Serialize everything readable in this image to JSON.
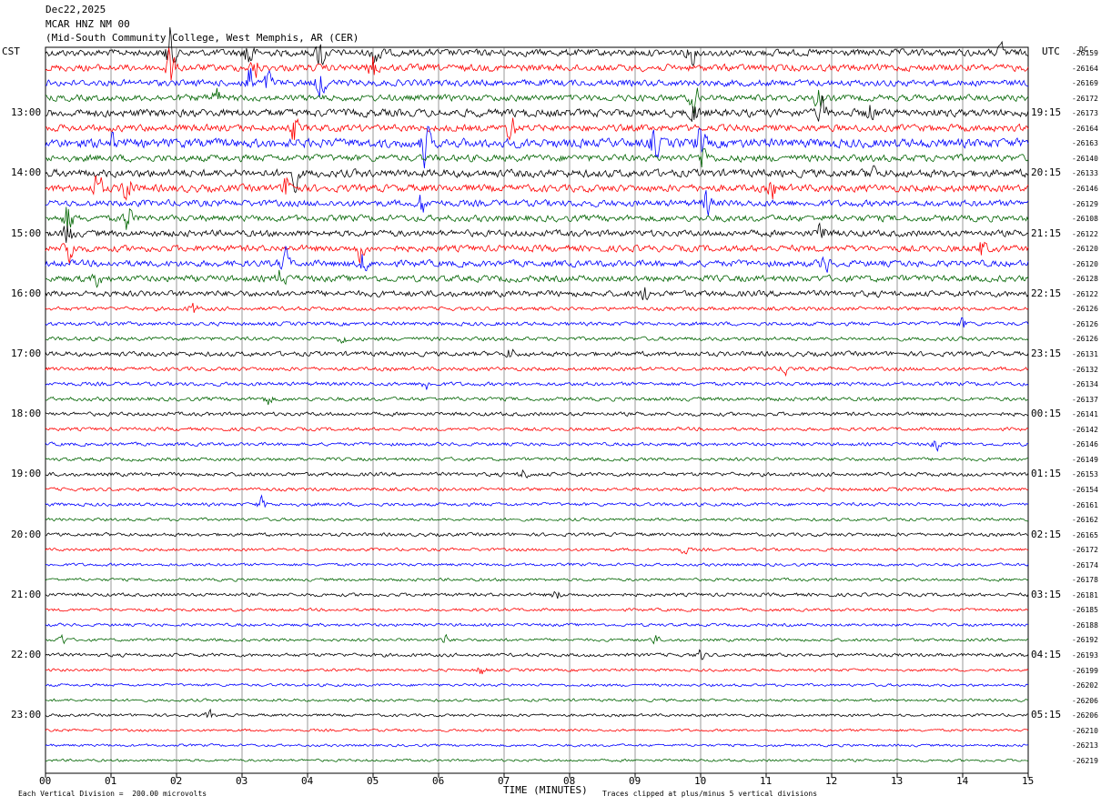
{
  "header": {
    "date": "Dec22,2025",
    "station": "MCAR HNZ NM 00",
    "location": "(Mid-South Community College, West Memphis, AR (CER)"
  },
  "axis": {
    "left_tz": "CST",
    "right_tz": "UTC",
    "dc_label": "DC",
    "x_title": "TIME (MINUTES)",
    "scale_note": "Each Vertical Division =  200.00 microvolts",
    "clip_note": "Traces clipped at plus/minus 5 vertical divisions"
  },
  "chart_data": {
    "type": "line",
    "title": "MCAR HNZ NM 00",
    "xlabel": "TIME (MINUTES)",
    "xlim": [
      0,
      15
    ],
    "x_ticks": [
      "00",
      "01",
      "02",
      "03",
      "04",
      "05",
      "06",
      "07",
      "08",
      "09",
      "10",
      "11",
      "12",
      "13",
      "14",
      "15"
    ],
    "series_colors": [
      "#000000",
      "#ff0000",
      "#0000ff",
      "#006400"
    ],
    "left_hour_labels": [
      {
        "row": 4,
        "text": "13:00"
      },
      {
        "row": 8,
        "text": "14:00"
      },
      {
        "row": 12,
        "text": "15:00"
      },
      {
        "row": 16,
        "text": "16:00"
      },
      {
        "row": 20,
        "text": "17:00"
      },
      {
        "row": 24,
        "text": "18:00"
      },
      {
        "row": 28,
        "text": "19:00"
      },
      {
        "row": 32,
        "text": "20:00"
      },
      {
        "row": 36,
        "text": "21:00"
      },
      {
        "row": 40,
        "text": "22:00"
      },
      {
        "row": 44,
        "text": "23:00"
      }
    ],
    "right_hour_labels": [
      {
        "row": 4,
        "text": "19:15"
      },
      {
        "row": 8,
        "text": "20:15"
      },
      {
        "row": 12,
        "text": "21:15"
      },
      {
        "row": 16,
        "text": "22:15"
      },
      {
        "row": 20,
        "text": "23:15"
      },
      {
        "row": 24,
        "text": "00:15"
      },
      {
        "row": 28,
        "text": "01:15"
      },
      {
        "row": 32,
        "text": "02:15"
      },
      {
        "row": 36,
        "text": "03:15"
      },
      {
        "row": 40,
        "text": "04:15"
      },
      {
        "row": 44,
        "text": "05:15"
      }
    ],
    "dc_offsets": [
      "-26159",
      "-26164",
      "-26169",
      "-26172",
      "-26173",
      "-26164",
      "-26163",
      "-26140",
      "-26133",
      "-26146",
      "-26129",
      "-26108",
      "-26122",
      "-26120",
      "-26120",
      "-26128",
      "-26122",
      "-26126",
      "-26126",
      "-26126",
      "-26131",
      "-26132",
      "-26134",
      "-26137",
      "-26141",
      "-26142",
      "-26146",
      "-26149",
      "-26153",
      "-26154",
      "-26161",
      "-26162",
      "-26165",
      "-26172",
      "-26174",
      "-26178",
      "-26181",
      "-26185",
      "-26188",
      "-26192",
      "-26193",
      "-26199",
      "-26202",
      "-26206",
      "-26206",
      "-26210",
      "-26213",
      "-26219"
    ],
    "row_amplitudes": [
      3.2,
      3.2,
      3.0,
      3.0,
      3.6,
      3.2,
      4.2,
      3.2,
      3.6,
      3.4,
      3.0,
      3.0,
      3.0,
      3.0,
      3.0,
      3.0,
      2.8,
      1.8,
      1.8,
      1.8,
      2.2,
      1.8,
      1.8,
      1.8,
      1.8,
      1.6,
      1.6,
      1.6,
      1.8,
      1.6,
      1.6,
      1.4,
      1.6,
      1.4,
      1.4,
      1.4,
      1.6,
      1.4,
      1.4,
      1.4,
      1.6,
      1.3,
      1.3,
      1.3,
      1.3,
      1.2,
      1.2,
      1.2
    ],
    "events": [
      {
        "row": 0,
        "t": 1.9,
        "amp": 24
      },
      {
        "row": 0,
        "t": 3.1,
        "amp": 20
      },
      {
        "row": 0,
        "t": 4.2,
        "amp": 18
      },
      {
        "row": 0,
        "t": 5.05,
        "amp": 20
      },
      {
        "row": 0,
        "t": 9.85,
        "amp": 10
      },
      {
        "row": 0,
        "t": 14.6,
        "amp": 8
      },
      {
        "row": 1,
        "t": 1.9,
        "amp": 22
      },
      {
        "row": 1,
        "t": 5.0,
        "amp": 12
      },
      {
        "row": 1,
        "t": 3.2,
        "amp": 10
      },
      {
        "row": 2,
        "t": 3.1,
        "amp": 18
      },
      {
        "row": 2,
        "t": 4.2,
        "amp": 16
      },
      {
        "row": 2,
        "t": 3.4,
        "amp": 10
      },
      {
        "row": 3,
        "t": 2.6,
        "amp": 10
      },
      {
        "row": 3,
        "t": 9.9,
        "amp": 14
      },
      {
        "row": 3,
        "t": 11.8,
        "amp": 10
      },
      {
        "row": 4,
        "t": 11.85,
        "amp": 14
      },
      {
        "row": 4,
        "t": 9.9,
        "amp": 12
      },
      {
        "row": 4,
        "t": 12.6,
        "amp": 8
      },
      {
        "row": 5,
        "t": 7.1,
        "amp": 14
      },
      {
        "row": 5,
        "t": 3.8,
        "amp": 12
      },
      {
        "row": 6,
        "t": 5.8,
        "amp": 20
      },
      {
        "row": 6,
        "t": 9.3,
        "amp": 14
      },
      {
        "row": 6,
        "t": 10.0,
        "amp": 16
      },
      {
        "row": 6,
        "t": 1.0,
        "amp": 8
      },
      {
        "row": 7,
        "t": 10.05,
        "amp": 14
      },
      {
        "row": 8,
        "t": 3.8,
        "amp": 12
      },
      {
        "row": 8,
        "t": 12.6,
        "amp": 8
      },
      {
        "row": 9,
        "t": 0.8,
        "amp": 16
      },
      {
        "row": 9,
        "t": 1.25,
        "amp": 20
      },
      {
        "row": 9,
        "t": 3.7,
        "amp": 16
      },
      {
        "row": 9,
        "t": 11.1,
        "amp": 8
      },
      {
        "row": 10,
        "t": 5.75,
        "amp": 10
      },
      {
        "row": 10,
        "t": 10.1,
        "amp": 12
      },
      {
        "row": 11,
        "t": 0.35,
        "amp": 18
      },
      {
        "row": 11,
        "t": 1.25,
        "amp": 14
      },
      {
        "row": 12,
        "t": 11.85,
        "amp": 12
      },
      {
        "row": 12,
        "t": 0.35,
        "amp": 16
      },
      {
        "row": 13,
        "t": 0.35,
        "amp": 18
      },
      {
        "row": 13,
        "t": 4.8,
        "amp": 10
      },
      {
        "row": 13,
        "t": 14.3,
        "amp": 8
      },
      {
        "row": 14,
        "t": 3.65,
        "amp": 14
      },
      {
        "row": 14,
        "t": 4.85,
        "amp": 10
      },
      {
        "row": 14,
        "t": 11.9,
        "amp": 8
      },
      {
        "row": 15,
        "t": 3.6,
        "amp": 10
      },
      {
        "row": 15,
        "t": 0.8,
        "amp": 6
      },
      {
        "row": 16,
        "t": 9.15,
        "amp": 6
      },
      {
        "row": 17,
        "t": 2.25,
        "amp": 6
      },
      {
        "row": 18,
        "t": 14.0,
        "amp": 5
      },
      {
        "row": 19,
        "t": 4.55,
        "amp": 5
      },
      {
        "row": 20,
        "t": 7.1,
        "amp": 5
      },
      {
        "row": 21,
        "t": 11.3,
        "amp": 6
      },
      {
        "row": 22,
        "t": 5.8,
        "amp": 6
      },
      {
        "row": 23,
        "t": 3.4,
        "amp": 5
      },
      {
        "row": 26,
        "t": 13.6,
        "amp": 5
      },
      {
        "row": 28,
        "t": 7.3,
        "amp": 5
      },
      {
        "row": 30,
        "t": 3.3,
        "amp": 6
      },
      {
        "row": 33,
        "t": 9.75,
        "amp": 4
      },
      {
        "row": 36,
        "t": 7.8,
        "amp": 4
      },
      {
        "row": 39,
        "t": 0.25,
        "amp": 5
      },
      {
        "row": 39,
        "t": 6.1,
        "amp": 4
      },
      {
        "row": 39,
        "t": 9.3,
        "amp": 4
      },
      {
        "row": 40,
        "t": 10.0,
        "amp": 5
      },
      {
        "row": 41,
        "t": 6.65,
        "amp": 5
      },
      {
        "row": 44,
        "t": 2.5,
        "amp": 4
      }
    ]
  }
}
